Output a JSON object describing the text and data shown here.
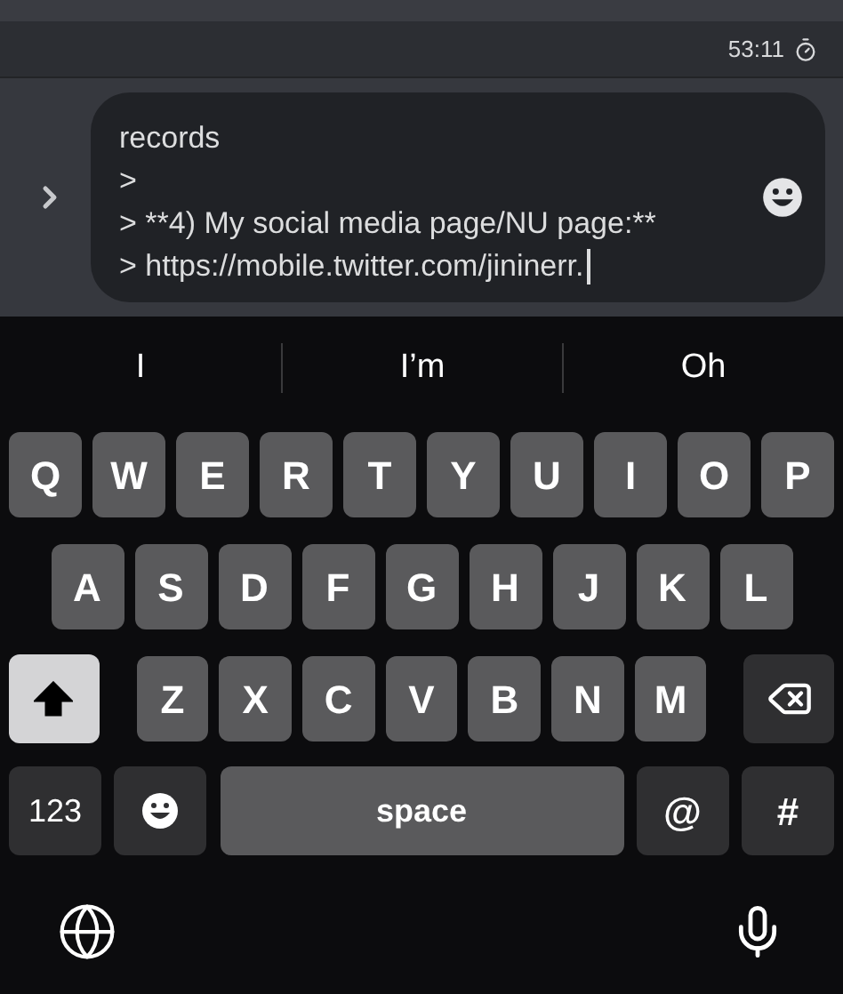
{
  "header": {
    "timer": "53:11"
  },
  "composer": {
    "lines": [
      "records",
      ">",
      "> **4) My social media page/NU page:**",
      "> https://mobile.twitter.com/jininerr."
    ]
  },
  "suggestions": [
    {
      "text": "I"
    },
    {
      "text": "I’m"
    },
    {
      "text": "Oh"
    }
  ],
  "keyboard": {
    "rows": [
      {
        "keys": [
          {
            "kind": "letter",
            "label": "Q"
          },
          {
            "kind": "letter",
            "label": "W"
          },
          {
            "kind": "letter",
            "label": "E"
          },
          {
            "kind": "letter",
            "label": "R"
          },
          {
            "kind": "letter",
            "label": "T"
          },
          {
            "kind": "letter",
            "label": "Y"
          },
          {
            "kind": "letter",
            "label": "U"
          },
          {
            "kind": "letter",
            "label": "I"
          },
          {
            "kind": "letter",
            "label": "O"
          },
          {
            "kind": "letter",
            "label": "P"
          }
        ]
      },
      {
        "keys": [
          {
            "kind": "letter",
            "label": "A"
          },
          {
            "kind": "letter",
            "label": "S"
          },
          {
            "kind": "letter",
            "label": "D"
          },
          {
            "kind": "letter",
            "label": "F"
          },
          {
            "kind": "letter",
            "label": "G"
          },
          {
            "kind": "letter",
            "label": "H"
          },
          {
            "kind": "letter",
            "label": "J"
          },
          {
            "kind": "letter",
            "label": "K"
          },
          {
            "kind": "letter",
            "label": "L"
          }
        ]
      },
      {
        "keys": [
          {
            "kind": "shift",
            "on": true
          },
          {
            "kind": "letter",
            "label": "Z"
          },
          {
            "kind": "letter",
            "label": "X"
          },
          {
            "kind": "letter",
            "label": "C"
          },
          {
            "kind": "letter",
            "label": "V"
          },
          {
            "kind": "letter",
            "label": "B"
          },
          {
            "kind": "letter",
            "label": "N"
          },
          {
            "kind": "letter",
            "label": "M"
          },
          {
            "kind": "delete"
          }
        ]
      },
      {
        "keys": [
          {
            "kind": "mode",
            "label": "123"
          },
          {
            "kind": "emoji"
          },
          {
            "kind": "space",
            "label": "space"
          },
          {
            "kind": "symbol",
            "label": "@"
          },
          {
            "kind": "symbol",
            "label": "#"
          }
        ]
      }
    ]
  }
}
